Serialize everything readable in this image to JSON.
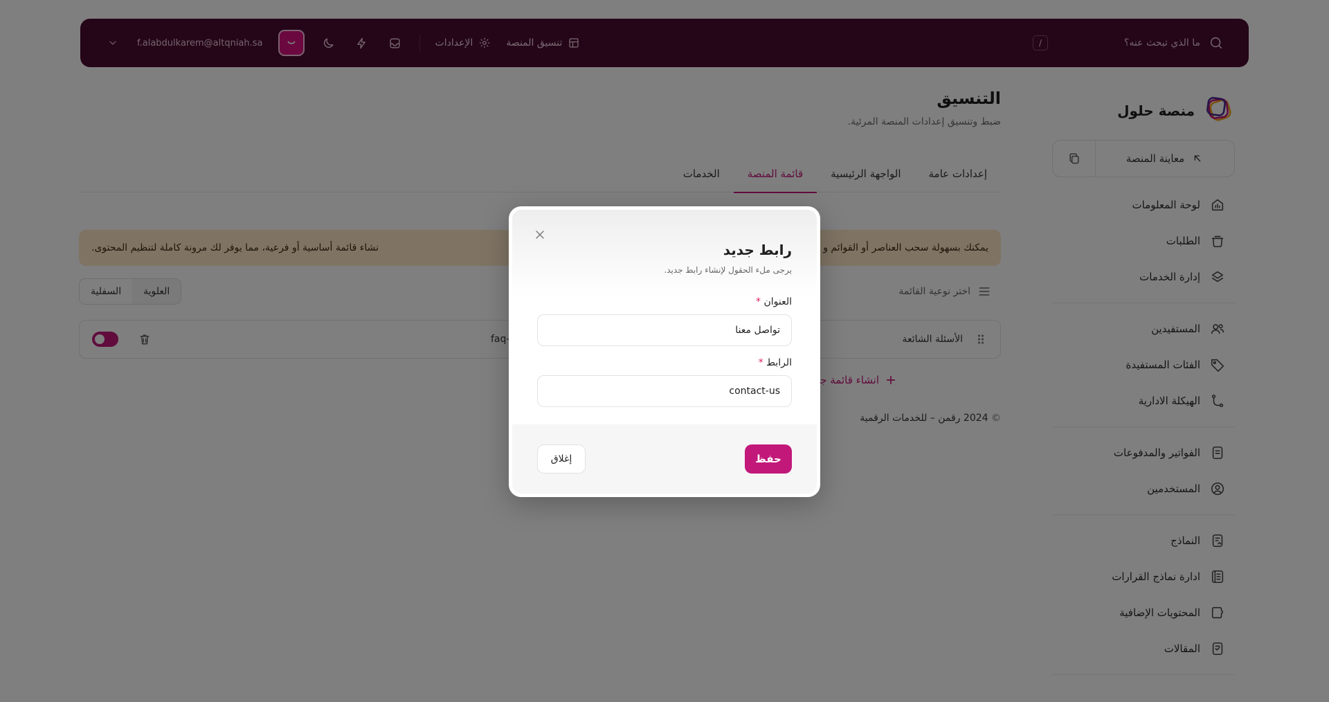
{
  "topbar": {
    "search_placeholder": "ما الذي تبحث عنه؟",
    "search_shortcut": "/",
    "platform_layout_label": "تنسيق المنصة",
    "settings_label": "الإعدادات",
    "email": "f.alabdulkarem@altqniah.sa"
  },
  "sidebar": {
    "brand_name": "منصة حلول",
    "preview_label": "معاينة المنصة",
    "groups": [
      [
        {
          "label": "لوحة المعلومات",
          "icon": "chart-icon"
        },
        {
          "label": "الطلبات",
          "icon": "tray-icon"
        },
        {
          "label": "إدارة الخدمات",
          "icon": "layers-icon"
        }
      ],
      [
        {
          "label": "المستفيدين",
          "icon": "users-icon"
        },
        {
          "label": "الفئات المستفيدة",
          "icon": "tag-icon"
        },
        {
          "label": "الهيكلة الادارية",
          "icon": "branch-icon"
        }
      ],
      [
        {
          "label": "الفواتير والمدفوعات",
          "icon": "invoice-icon"
        },
        {
          "label": "المستخدمين",
          "icon": "user-circle-icon"
        }
      ],
      [
        {
          "label": "النماذج",
          "icon": "form-icon"
        },
        {
          "label": "ادارة نماذج القرارات",
          "icon": "list-icon"
        },
        {
          "label": "المحتويات الإضافية",
          "icon": "puzzle-icon"
        },
        {
          "label": "المقالات",
          "icon": "article-icon"
        }
      ]
    ]
  },
  "main": {
    "title": "التنسيق",
    "subtitle": "ضبط وتنسيق إعدادات المنصة المرئية.",
    "tabs": [
      "إعدادات عامة",
      "الواجهة الرئيسية",
      "قائمة المنصة",
      "الخدمات"
    ],
    "active_tab": 2,
    "notice_start": "يمكنك بسهولة سحب العناصر أو القوائم و",
    "notice_end": "نشاء قائمة أساسية أو فرعية، مما يوفر لك مرونة كاملة لتنظيم المحتوى.",
    "menu_type_label": "اختر نوعية القائمة",
    "segments": [
      "العلوية",
      "السفلية"
    ],
    "active_segment": 0,
    "menu_row": {
      "title": "الأسئلة الشائعة",
      "slug": "faq-",
      "enabled": true
    },
    "add_menu_label": "انشاء قائمة جديدة",
    "copyright": "2024 رقمن – للخدمات الرقمية",
    "copyright_symbol": "©"
  },
  "modal": {
    "title": "رابط جديد",
    "subtitle": "يرجى ملء الحقول لإنشاء رابط جديد.",
    "title_field_label": "العنوان",
    "title_field_value": "تواصل معنا",
    "url_field_label": "الرابط",
    "url_field_value": "contact-us",
    "required_mark": "*",
    "save_label": "حفظ",
    "close_label": "إغلاق"
  },
  "colors": {
    "topbar_bg": "#4a0a31",
    "accent": "#c2187a",
    "notice_bg": "#ffe8c8",
    "overlay": "rgba(0,0,0,0.5)"
  }
}
